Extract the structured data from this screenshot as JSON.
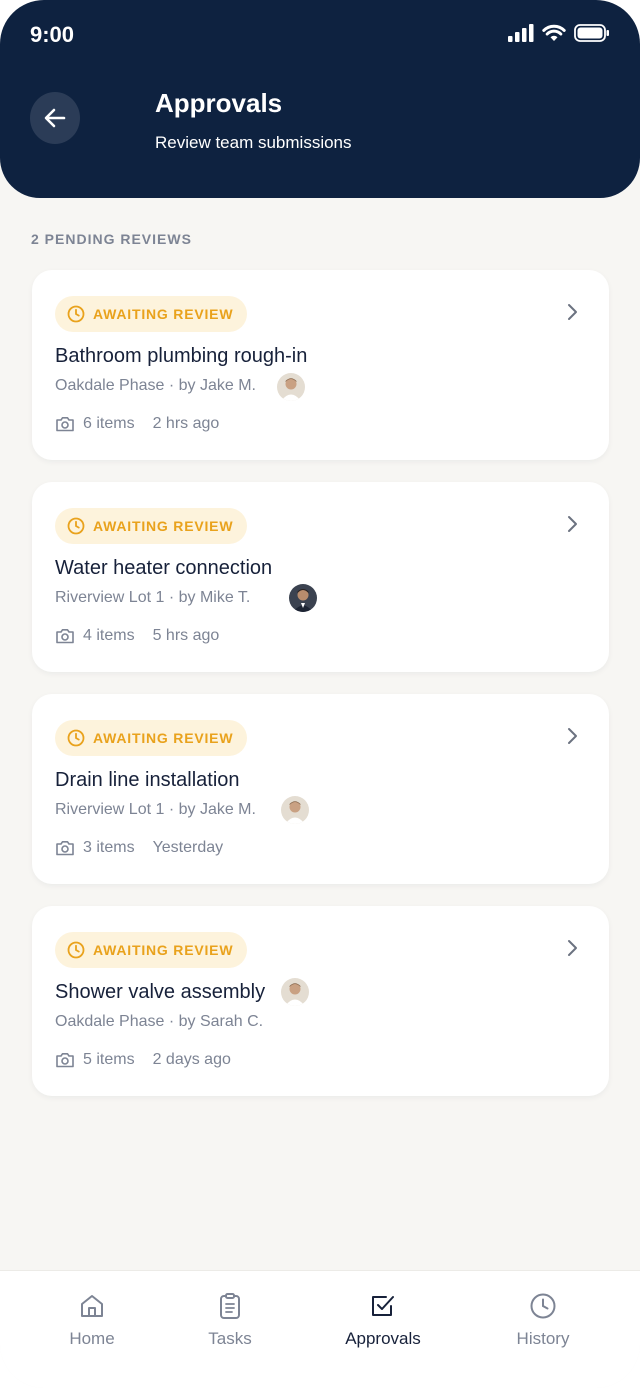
{
  "status_bar": {
    "time": "9:00"
  },
  "header": {
    "title": "Approvals",
    "subtitle": "Review team submissions",
    "back_icon": "arrow-left-icon"
  },
  "section_label": "2 PENDING REVIEWS",
  "cards": [
    {
      "badge": "AWAITING REVIEW",
      "title": "Bathroom plumbing rough-in",
      "meta": "Oakdale Phase  · by Jake M.",
      "items": "6 items",
      "time": "2 hrs ago"
    },
    {
      "badge": "AWAITING REVIEW",
      "title": "Water heater connection",
      "meta": "Riverview Lot 1 · by Mike T.",
      "items": "4 items",
      "time": "5 hrs ago"
    },
    {
      "badge": "AWAITING REVIEW",
      "title": "Drain line installation",
      "meta": "Riverview Lot 1 · by Jake M.",
      "items": "3 items",
      "time": "Yesterday"
    },
    {
      "badge": "AWAITING REVIEW",
      "title": "Shower valve assembly",
      "meta": "Oakdale Phase  · by Sarah C.",
      "items": "5 items",
      "time": "2 days ago"
    }
  ],
  "tabs": [
    {
      "label": "Home",
      "icon": "home-icon",
      "active": false
    },
    {
      "label": "Tasks",
      "icon": "clipboard-icon",
      "active": false
    },
    {
      "label": "Approvals",
      "icon": "checkbox-icon",
      "active": true
    },
    {
      "label": "History",
      "icon": "clock-icon",
      "active": false
    }
  ],
  "colors": {
    "header_bg": "#0e2240",
    "page_bg": "#f7f6f3",
    "badge_bg": "#fdf3dc",
    "badge_text": "#e9a21c",
    "title_text": "#17213a",
    "muted_text": "#7d8494"
  }
}
